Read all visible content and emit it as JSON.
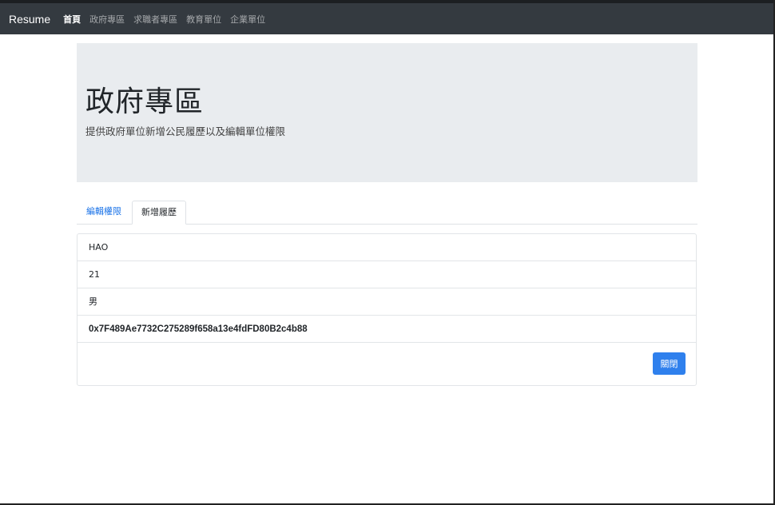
{
  "navbar": {
    "brand": "Resume",
    "links": [
      "首頁",
      "政府專區",
      "求職者專區",
      "教育單位",
      "企業單位"
    ]
  },
  "jumbotron": {
    "title": "政府專區",
    "lead": "提供政府單位新增公民履歷以及編輯單位權限"
  },
  "tabs": {
    "edit_permission": "編輯權限",
    "add_resume": "新增履歷"
  },
  "record": {
    "name": "HAO",
    "age": "21",
    "gender": "男",
    "address": "0x7F489Ae7732C275289f658a13e4fdFD80B2c4b88"
  },
  "actions": {
    "close_label": "關閉"
  },
  "colors": {
    "navbar_bg": "#343a40",
    "jumbotron_bg": "#e9ecef",
    "accent": "#2f80ed"
  }
}
